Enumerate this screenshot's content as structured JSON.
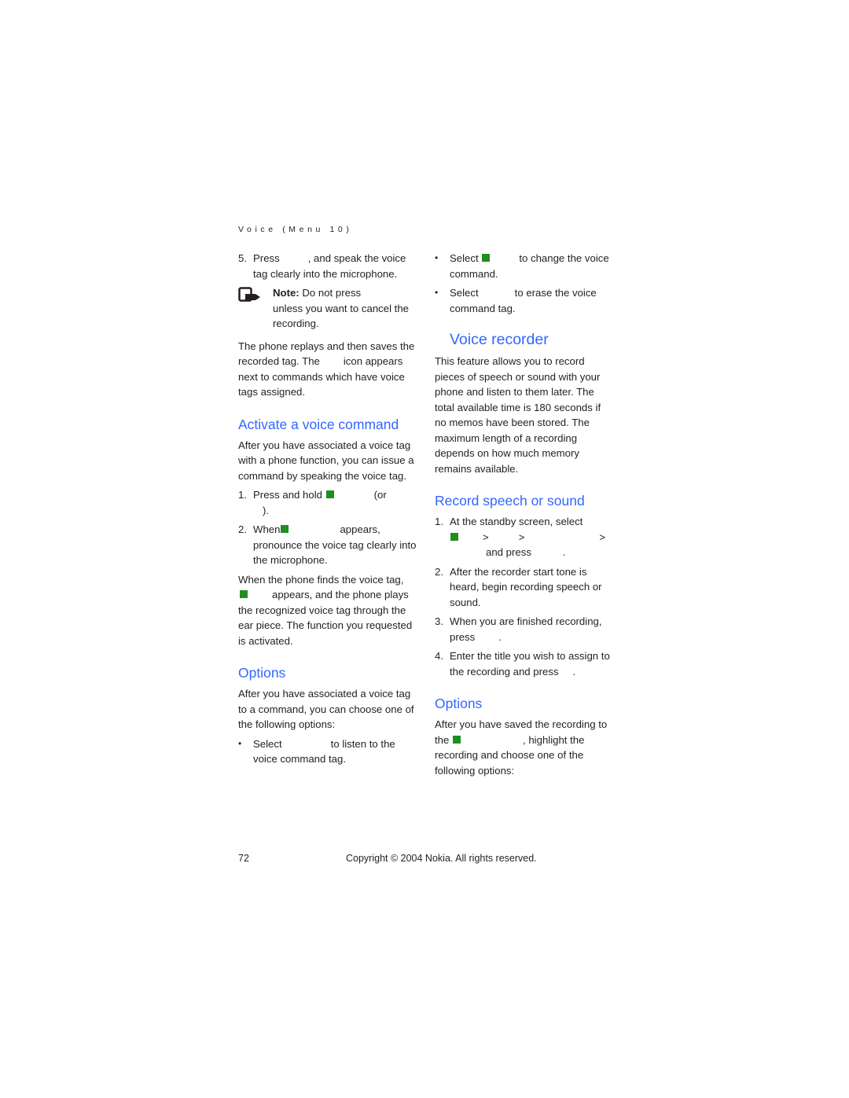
{
  "header": {
    "running_title": "Voice (Menu 10)"
  },
  "left_column": {
    "step5": {
      "number": "5.",
      "text_a": "Press",
      "text_b": ", and speak the voice tag clearly into the microphone."
    },
    "note": {
      "label": "Note:",
      "text_a": " Do not press",
      "text_b": "unless you want to cancel the recording."
    },
    "replay_paragraph": {
      "text_a": "The phone replays and then saves the recorded tag. The",
      "text_b": "icon appears next to commands which have voice tags assigned."
    },
    "activate_heading": "Activate a voice command",
    "activate_intro": "After you have associated a voice tag with a phone function, you can issue a command by speaking the voice tag.",
    "activate_steps": [
      {
        "number": "1.",
        "text_a": "Press and hold",
        "text_b": "(or",
        "text_c": ")."
      },
      {
        "number": "2.",
        "text_a": "When",
        "text_b": "appears, pronounce the voice tag clearly into the microphone."
      }
    ],
    "found_paragraph": {
      "text_a": "When the phone finds the voice tag,",
      "text_b": "appears, and the phone plays the recognized voice tag through the ear piece. The function you requested is activated."
    },
    "options_heading": "Options",
    "options_intro": "After you have associated a voice tag to a command, you can choose one of the following options:",
    "options_bullets": [
      {
        "bullet": "•",
        "text_a": "Select",
        "text_b": "to listen to the voice command tag."
      }
    ]
  },
  "right_column": {
    "options_bullets_cont": [
      {
        "bullet": "•",
        "text_a": "Select",
        "text_b": "to change the voice command."
      },
      {
        "bullet": "•",
        "text_a": "Select",
        "text_b": "to erase the voice command tag."
      }
    ],
    "recorder_heading": "Voice recorder",
    "recorder_intro": "This feature allows you to record pieces of speech or sound with your phone and listen to them later. The total available time is 180 seconds if no memos have been stored. The maximum length of a recording depends on how much memory remains available.",
    "record_heading": "Record speech or sound",
    "record_steps": [
      {
        "number": "1.",
        "text_a": "At the standby screen, select",
        "sep1": ">",
        "sep2": ">",
        "sep3": ">",
        "text_b": "and press",
        "text_c": "."
      },
      {
        "number": "2.",
        "text_a": "After the recorder start tone is heard, begin recording speech or sound."
      },
      {
        "number": "3.",
        "text_a": "When you are finished recording, press",
        "text_b": "."
      },
      {
        "number": "4.",
        "text_a": "Enter the title you wish to assign to the recording and press",
        "text_b": "."
      }
    ],
    "options_heading": "Options",
    "options_intro": {
      "text_a": "After you have saved the recording to the",
      "text_b": ", highlight the recording and choose one of the following options:"
    }
  },
  "footer": {
    "page_number": "72",
    "copyright": "Copyright © 2004 Nokia. All rights reserved."
  },
  "colors": {
    "heading_blue": "#3366ff",
    "softkey_green": "#1f8f1f",
    "text": "#231f20"
  }
}
